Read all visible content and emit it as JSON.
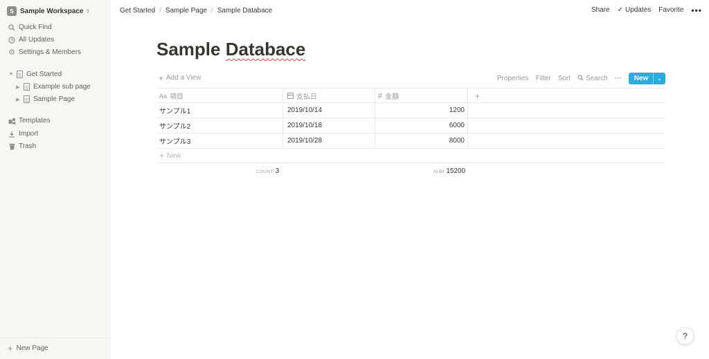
{
  "sidebar": {
    "workspace": {
      "badge": "S",
      "name": "Sample Workspace"
    },
    "nav": [
      {
        "label": "Quick Find",
        "icon": "search-icon"
      },
      {
        "label": "All Updates",
        "icon": "clock-icon"
      },
      {
        "label": "Settings & Members",
        "icon": "gear-icon"
      }
    ],
    "pages": [
      {
        "label": "Get Started",
        "expanded": true
      },
      {
        "label": "Example sub page"
      },
      {
        "label": "Sample Page"
      }
    ],
    "tools": [
      {
        "label": "Templates",
        "icon": "templates-icon"
      },
      {
        "label": "Import",
        "icon": "import-icon"
      },
      {
        "label": "Trash",
        "icon": "trash-icon"
      }
    ],
    "new_page": "New Page"
  },
  "breadcrumb": [
    "Get Started",
    "Sample Page",
    "Sample Databace"
  ],
  "topbar": {
    "share": "Share",
    "updates": "Updates",
    "favorite": "Favorite",
    "more": "•••"
  },
  "page": {
    "title_word1": "Sample",
    "title_word2": "Databace"
  },
  "view": {
    "add_view": "Add a View",
    "properties": "Properties",
    "filter": "Filter",
    "sort": "Sort",
    "search": "Search",
    "more": "···",
    "new": "New"
  },
  "table": {
    "columns": [
      {
        "label": "項目",
        "icon": "Aa"
      },
      {
        "label": "支払日",
        "icon": "calendar-icon"
      },
      {
        "label": "金額",
        "icon": "#"
      }
    ],
    "add_column": "+",
    "rows": [
      {
        "item": "サンプル1",
        "date": "2019/10/14",
        "amount": "1200"
      },
      {
        "item": "サンプル2",
        "date": "2019/10/18",
        "amount": "6000"
      },
      {
        "item": "サンプル3",
        "date": "2019/10/28",
        "amount": "8000"
      }
    ],
    "new_row": "New",
    "count_label": "COUNT",
    "count_value": "3",
    "sum_label": "SUM",
    "sum_value": "15200"
  },
  "help": "?",
  "colors": {
    "sidebar_bg": "#f7f6f3",
    "accent": "#2eaadc",
    "text": "#37352f",
    "muted": "#9b9a97"
  }
}
